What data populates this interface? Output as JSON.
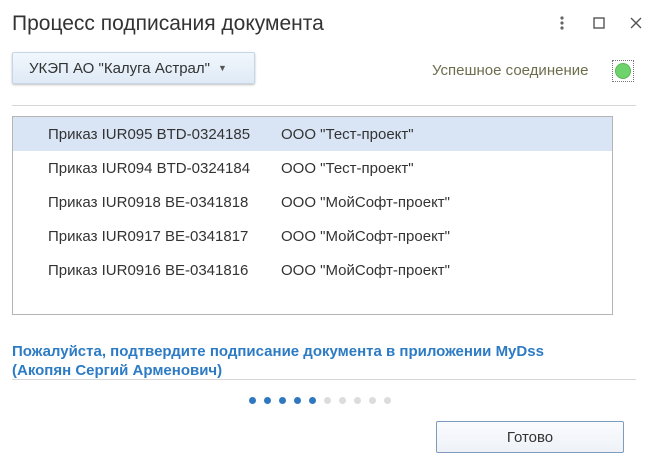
{
  "window": {
    "title": "Процесс подписания документа",
    "menu_icon": "vertical-ellipsis",
    "maximize_icon": "square",
    "close_icon": "x"
  },
  "certificate": {
    "label": "УКЭП АО \"Калуга Астрал\"",
    "caret_icon": "triangle-down"
  },
  "connection": {
    "status": "Успешное соединение",
    "indicator_color": "#6dd36a"
  },
  "documents": [
    {
      "doc": "Приказ IUR095 BTD-0324185",
      "org": "ООО \"Тест-проект\"",
      "selected": true
    },
    {
      "doc": "Приказ IUR094 BTD-0324184",
      "org": "ООО \"Тест-проект\"",
      "selected": false
    },
    {
      "doc": "Приказ IUR0918 BE-0341818",
      "org": "ООО \"МойСофт-проект\"",
      "selected": false
    },
    {
      "doc": "Приказ IUR0917 BE-0341817",
      "org": "ООО \"МойСофт-проект\"",
      "selected": false
    },
    {
      "doc": "Приказ IUR0916 BE-0341816",
      "org": "ООО \"МойСофт-проект\"",
      "selected": false
    }
  ],
  "message": {
    "line1": "Пожалуйста, подтвердите подписание документа в приложении MyDss",
    "line2": "(Акопян Сергий Арменович)"
  },
  "progress": {
    "total": 10,
    "active": 5,
    "active_color": "#2f78c0"
  },
  "footer": {
    "done_label": "Готово"
  }
}
